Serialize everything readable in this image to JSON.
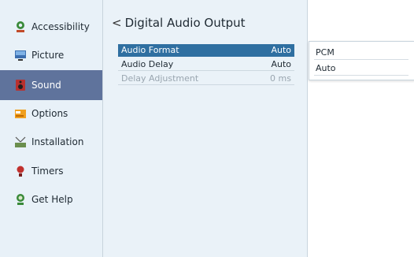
{
  "sidebar": {
    "items": [
      {
        "label": "Accessibility",
        "icon": "accessibility-icon"
      },
      {
        "label": "Picture",
        "icon": "picture-icon"
      },
      {
        "label": "Sound",
        "icon": "speaker-icon"
      },
      {
        "label": "Options",
        "icon": "options-icon"
      },
      {
        "label": "Installation",
        "icon": "antenna-icon"
      },
      {
        "label": "Timers",
        "icon": "timer-icon"
      },
      {
        "label": "Get Help",
        "icon": "help-icon"
      }
    ],
    "active_index": 2
  },
  "main": {
    "back_glyph": "<",
    "title": "Digital Audio Output",
    "rows": [
      {
        "label": "Audio Format",
        "value": "Auto",
        "state": "selected"
      },
      {
        "label": "Audio Delay",
        "value": "Auto",
        "state": "normal"
      },
      {
        "label": "Delay Adjustment",
        "value": "0 ms",
        "state": "disabled"
      }
    ]
  },
  "dropdown": {
    "options": [
      "PCM",
      "Auto"
    ]
  },
  "colors": {
    "sidebar_active_bg": "#5f739c",
    "row_selected_bg": "#2f6fa1",
    "background": "#eaf2f8"
  }
}
